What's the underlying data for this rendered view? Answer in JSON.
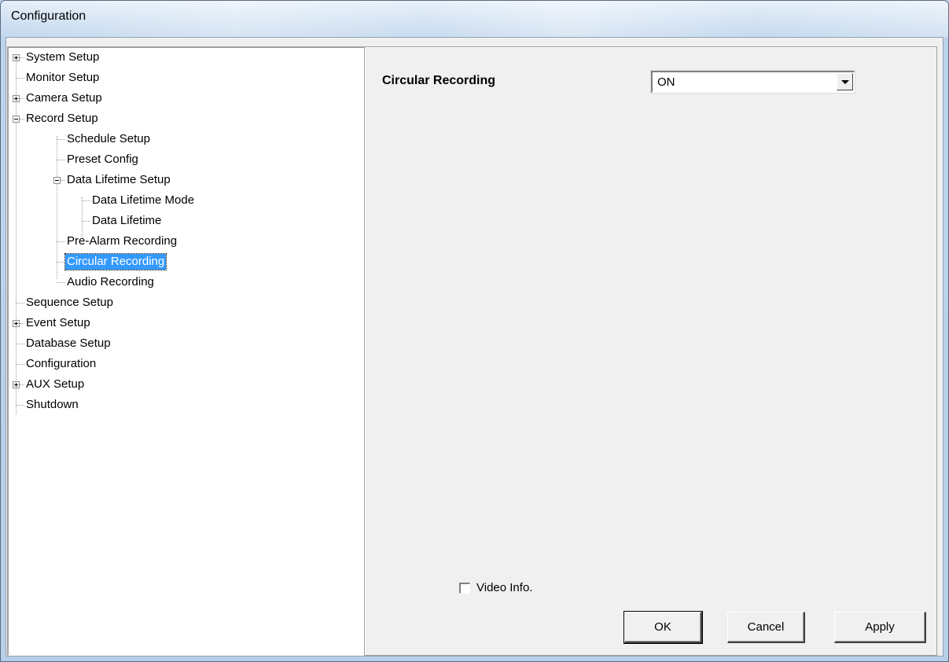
{
  "window": {
    "title": "Configuration"
  },
  "tree": {
    "items": [
      {
        "label": "System Setup",
        "expander": "plus"
      },
      {
        "label": "Monitor Setup"
      },
      {
        "label": "Camera Setup",
        "expander": "plus"
      },
      {
        "label": "Record Setup",
        "expander": "minus"
      },
      {
        "label": "Schedule Setup"
      },
      {
        "label": "Preset Config"
      },
      {
        "label": "Data Lifetime Setup",
        "expander": "minus"
      },
      {
        "label": "Data Lifetime Mode"
      },
      {
        "label": "Data Lifetime"
      },
      {
        "label": "Pre-Alarm Recording"
      },
      {
        "label": "Circular Recording",
        "selected": true
      },
      {
        "label": "Audio Recording"
      },
      {
        "label": "Sequence Setup"
      },
      {
        "label": "Event Setup",
        "expander": "plus"
      },
      {
        "label": "Database Setup"
      },
      {
        "label": "Configuration"
      },
      {
        "label": "AUX Setup",
        "expander": "plus"
      },
      {
        "label": "Shutdown"
      }
    ]
  },
  "panel": {
    "field_label": "Circular Recording",
    "combo_value": "ON"
  },
  "checkbox": {
    "label": "Video Info.",
    "checked": false
  },
  "buttons": {
    "ok": "OK",
    "cancel": "Cancel",
    "apply": "Apply"
  },
  "colors": {
    "selection": "#3399ff",
    "face": "#f0f0f0",
    "titlebar": "#c5d9ef"
  }
}
